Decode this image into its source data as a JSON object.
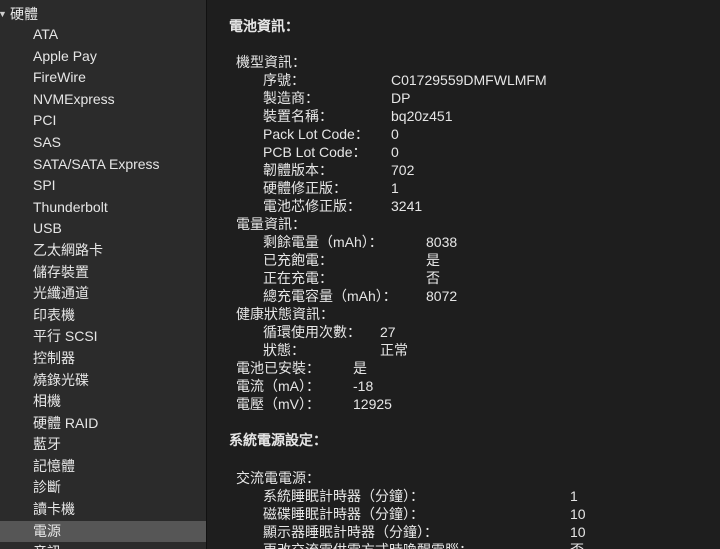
{
  "sidebar": {
    "header": "硬體",
    "items": [
      "ATA",
      "Apple Pay",
      "FireWire",
      "NVMExpress",
      "PCI",
      "SAS",
      "SATA/SATA Express",
      "SPI",
      "Thunderbolt",
      "USB",
      "乙太網路卡",
      "儲存裝置",
      "光纖通道",
      "印表機",
      "平行 SCSI",
      "控制器",
      "燒錄光碟",
      "相機",
      "硬體 RAID",
      "藍牙",
      "記憶體",
      "診斷",
      "讀卡機",
      "電源",
      "音訊"
    ],
    "selected_index": 23
  },
  "battery": {
    "title": "電池資訊：",
    "model_section": "機型資訊：",
    "model": [
      {
        "label": "序號：",
        "value": "C01729559DMFWLMFM"
      },
      {
        "label": "製造商：",
        "value": "DP"
      },
      {
        "label": "裝置名稱：",
        "value": "bq20z451"
      },
      {
        "label": "Pack Lot Code：",
        "value": "0"
      },
      {
        "label": "PCB Lot Code：",
        "value": "0"
      },
      {
        "label": "韌體版本：",
        "value": "702"
      },
      {
        "label": "硬體修正版：",
        "value": "1"
      },
      {
        "label": "電池芯修正版：",
        "value": "3241"
      }
    ],
    "charge_section": "電量資訊：",
    "charge": [
      {
        "label": "剩餘電量（mAh）：",
        "value": "8038"
      },
      {
        "label": "已充飽電：",
        "value": "是"
      },
      {
        "label": "正在充電：",
        "value": "否"
      },
      {
        "label": "總充電容量（mAh）：",
        "value": "8072"
      }
    ],
    "health_section": "健康狀態資訊：",
    "health": [
      {
        "label": "循環使用次數：",
        "value": "27"
      },
      {
        "label": "狀態：",
        "value": "正常"
      }
    ],
    "misc": [
      {
        "label": "電池已安裝：",
        "value": "是"
      },
      {
        "label": "電流（mA）：",
        "value": "-18"
      },
      {
        "label": "電壓（mV）：",
        "value": "12925"
      }
    ]
  },
  "power": {
    "title": "系統電源設定：",
    "ac_section": "交流電電源：",
    "ac": [
      {
        "label": "系統睡眠計時器（分鐘）：",
        "value": "1"
      },
      {
        "label": "磁碟睡眠計時器（分鐘）：",
        "value": "10"
      },
      {
        "label": "顯示器睡眠計時器（分鐘）：",
        "value": "10"
      },
      {
        "label": "更改交流電供電方式時喚醒電腦：",
        "value": "否"
      }
    ]
  }
}
